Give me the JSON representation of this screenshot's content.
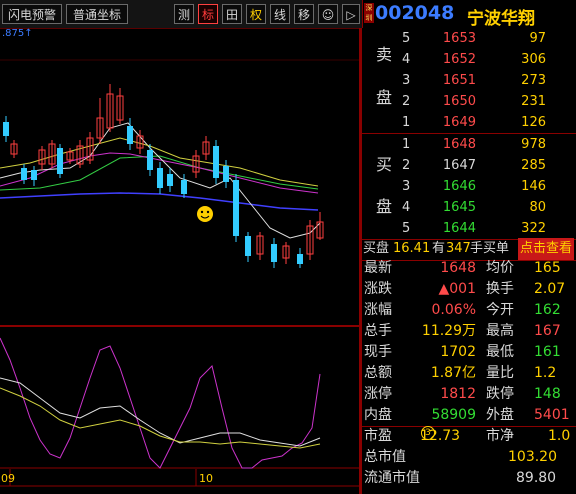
{
  "toolbar": {
    "buttons": [
      "闪电预警",
      "普通坐标",
      "测",
      "标",
      "田",
      "权",
      "线",
      "移",
      "☺",
      "▷"
    ]
  },
  "stock": {
    "market_tag": "深圳",
    "code": "002048",
    "name": "宁波华翔"
  },
  "chart": {
    "top_label": ".875↑",
    "axis_labels": [
      "09",
      "10"
    ]
  },
  "orderbook": {
    "sell_label_1": "卖",
    "sell_label_2": "盘",
    "buy_label_1": "买",
    "buy_label_2": "盘",
    "asks": [
      {
        "level": "5",
        "price": "1653",
        "vol": "97"
      },
      {
        "level": "4",
        "price": "1652",
        "vol": "306"
      },
      {
        "level": "3",
        "price": "1651",
        "vol": "273"
      },
      {
        "level": "2",
        "price": "1650",
        "vol": "231"
      },
      {
        "level": "1",
        "price": "1649",
        "vol": "126"
      }
    ],
    "bids": [
      {
        "level": "1",
        "price": "1648",
        "vol": "978"
      },
      {
        "level": "2",
        "price": "1647",
        "vol": "285"
      },
      {
        "level": "3",
        "price": "1646",
        "vol": "146"
      },
      {
        "level": "4",
        "price": "1645",
        "vol": "80"
      },
      {
        "level": "5",
        "price": "1644",
        "vol": "322"
      }
    ]
  },
  "extra": {
    "buy_label": "买盘",
    "buy_val": "16.41",
    "have": "有",
    "count": "347",
    "suffix": "手买单",
    "link": "点击查看"
  },
  "quote": [
    {
      "l1": "最新",
      "v1": "1648",
      "c1": "red",
      "l2": "均价",
      "v2": "165",
      "c2": "yel"
    },
    {
      "l1": "涨跌",
      "v1": "▲001",
      "c1": "red",
      "l2": "换手",
      "v2": "2.07",
      "c2": "yel"
    },
    {
      "l1": "涨幅",
      "v1": "0.06%",
      "c1": "red",
      "l2": "今开",
      "v2": "162",
      "c2": "grn"
    },
    {
      "l1": "总手",
      "v1": "11.29万",
      "c1": "yel",
      "l2": "最高",
      "v2": "167",
      "c2": "red"
    },
    {
      "l1": "现手",
      "v1": "1702",
      "c1": "yel",
      "l2": "最低",
      "v2": "161",
      "c2": "grn"
    },
    {
      "l1": "总额",
      "v1": "1.87亿",
      "c1": "yel",
      "l2": "量比",
      "v2": "1.2",
      "c2": "yel"
    },
    {
      "l1": "涨停",
      "v1": "1812",
      "c1": "red",
      "l2": "跌停",
      "v2": "148",
      "c2": "grn"
    },
    {
      "l1": "内盘",
      "v1": "58909",
      "c1": "grn",
      "l2": "外盘",
      "v2": "5401",
      "c2": "red"
    }
  ],
  "valuation": {
    "pe_label": "市盈",
    "pe_val": "12.73",
    "pe_mark": "3",
    "pb_label": "市净",
    "pb_val": "1.0",
    "total_label": "总市值",
    "total_val": "103.20",
    "float_label": "流通市值",
    "float_val": "89.80"
  },
  "colors": {
    "up": "#ff4b4b",
    "down": "#33dd33",
    "accent": "#ffd000",
    "border": "#8a0000"
  }
}
